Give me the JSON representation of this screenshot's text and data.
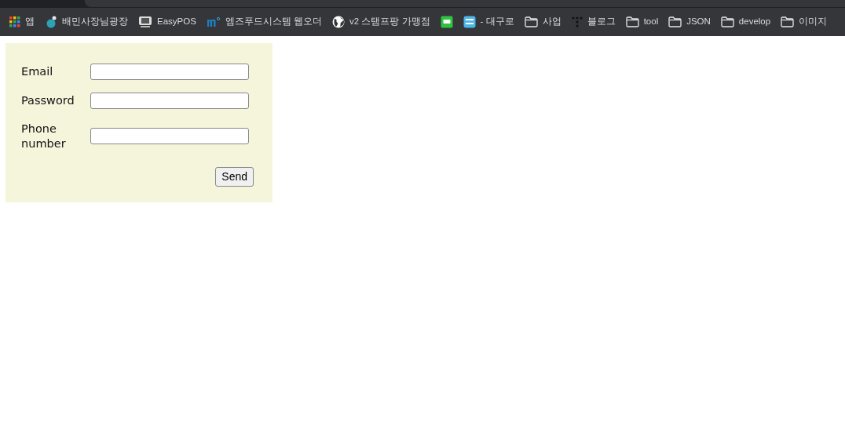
{
  "bookmarks_bar": {
    "items": [
      {
        "label": "앱",
        "kind": "grid"
      },
      {
        "label": "배민사장님광장",
        "kind": "badge"
      },
      {
        "label": "EasyPOS",
        "kind": "monitor"
      },
      {
        "label": "엠즈푸드시스템 웹오더",
        "kind": "letter"
      },
      {
        "label": "v2 스탬프팡 가맹점",
        "kind": "globe"
      },
      {
        "kind": "chat"
      },
      {
        "label": "- 대구로",
        "kind": "tile"
      },
      {
        "label": "사업",
        "kind": "folder"
      },
      {
        "label": "블로그",
        "kind": "dots"
      },
      {
        "label": "tool",
        "kind": "folder"
      },
      {
        "label": "JSON",
        "kind": "folder"
      },
      {
        "label": "develop",
        "kind": "folder"
      },
      {
        "label": "이미지",
        "kind": "folder"
      }
    ]
  },
  "form": {
    "fields": [
      {
        "label": "Email"
      },
      {
        "label": "Password"
      },
      {
        "label": "Phone number"
      }
    ],
    "submit": "Send"
  }
}
